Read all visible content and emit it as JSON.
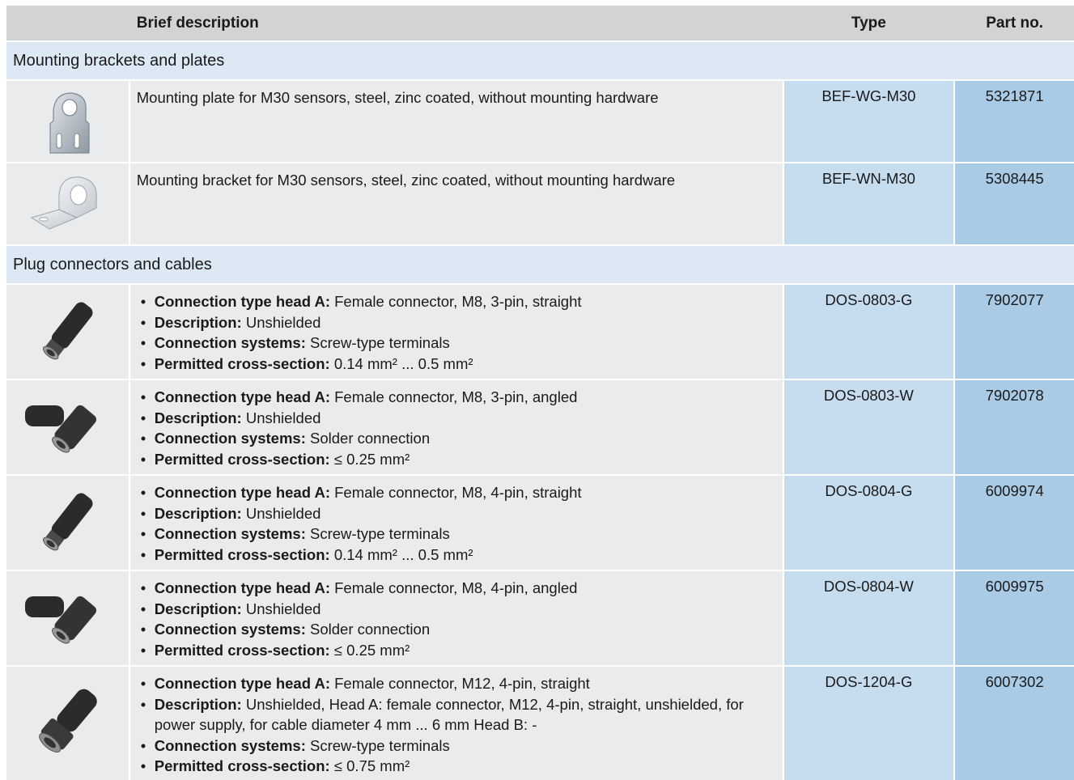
{
  "header": {
    "description": "Brief description",
    "type": "Type",
    "part_no": "Part no."
  },
  "sections": [
    {
      "title": "Mounting brackets and plates",
      "rows": [
        {
          "image": "mounting-plate-icon",
          "description": "Mounting plate for M30 sensors, steel, zinc coated, without mounting hardware",
          "type": "BEF-WG-M30",
          "part_no": "5321871"
        },
        {
          "image": "mounting-bracket-icon",
          "description": "Mounting bracket for M30 sensors, steel, zinc coated, without mounting hardware",
          "type": "BEF-WN-M30",
          "part_no": "5308445"
        }
      ]
    },
    {
      "title": "Plug connectors and cables",
      "rows": [
        {
          "image": "straight-connector-icon",
          "bullets": [
            {
              "label": "Connection type head A:",
              "value": " Female connector, M8, 3-pin, straight"
            },
            {
              "label": "Description:",
              "value": " Unshielded"
            },
            {
              "label": "Connection systems:",
              "value": " Screw-type terminals"
            },
            {
              "label": "Permitted cross-section:",
              "value": " 0.14 mm² ... 0.5 mm²"
            }
          ],
          "type": "DOS-0803-G",
          "part_no": "7902077"
        },
        {
          "image": "angled-connector-icon",
          "bullets": [
            {
              "label": "Connection type head A:",
              "value": " Female connector, M8, 3-pin, angled"
            },
            {
              "label": "Description:",
              "value": " Unshielded"
            },
            {
              "label": "Connection systems:",
              "value": " Solder connection"
            },
            {
              "label": "Permitted cross-section:",
              "value": " ≤ 0.25 mm²"
            }
          ],
          "type": "DOS-0803-W",
          "part_no": "7902078"
        },
        {
          "image": "straight-connector-icon",
          "bullets": [
            {
              "label": "Connection type head A:",
              "value": " Female connector, M8, 4-pin, straight"
            },
            {
              "label": "Description:",
              "value": " Unshielded"
            },
            {
              "label": "Connection systems:",
              "value": " Screw-type terminals"
            },
            {
              "label": "Permitted cross-section:",
              "value": " 0.14 mm² ... 0.5 mm²"
            }
          ],
          "type": "DOS-0804-G",
          "part_no": "6009974"
        },
        {
          "image": "angled-connector-icon",
          "bullets": [
            {
              "label": "Connection type head A:",
              "value": " Female connector, M8, 4-pin, angled"
            },
            {
              "label": "Description:",
              "value": " Unshielded"
            },
            {
              "label": "Connection systems:",
              "value": " Solder connection"
            },
            {
              "label": "Permitted cross-section:",
              "value": " ≤ 0.25 mm²"
            }
          ],
          "type": "DOS-0804-W",
          "part_no": "6009975"
        },
        {
          "image": "m12-connector-icon",
          "bullets": [
            {
              "label": "Connection type head A:",
              "value": " Female connector, M12, 4-pin, straight"
            },
            {
              "label": "Description:",
              "value": " Unshielded, Head A: female connector, M12, 4-pin, straight, unshielded, for power supply, for cable diameter 4 mm ... 6 mm Head B: -"
            },
            {
              "label": "Connection systems:",
              "value": " Screw-type terminals"
            },
            {
              "label": "Permitted cross-section:",
              "value": " ≤ 0.75 mm²"
            }
          ],
          "type": "DOS-1204-G",
          "part_no": "6007302"
        }
      ]
    }
  ],
  "colors": {
    "header_bg": "#d1d3d4",
    "section_bg": "#dce9f5",
    "cell_bg": "#eaebec",
    "type_bg": "#c6dcef",
    "part_bg": "#a9cbe6"
  }
}
